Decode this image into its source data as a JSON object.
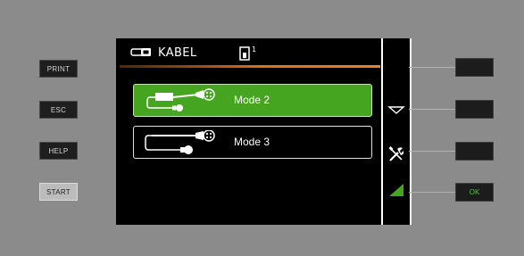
{
  "left_buttons": [
    {
      "label": "PRINT"
    },
    {
      "label": "ESC"
    },
    {
      "label": "HELP"
    },
    {
      "label": "START"
    }
  ],
  "screen": {
    "header": {
      "title": "KABEL",
      "cable_icon": "cable-plug-icon",
      "device_icon": "device-slot-icon",
      "device_index": "1",
      "accent_color": "#e86b17"
    },
    "modes": [
      {
        "label": "Mode 2",
        "icon": "cable-mode2-icon",
        "selected": true
      },
      {
        "label": "Mode 3",
        "icon": "cable-mode3-icon",
        "selected": false
      }
    ],
    "selected_color": "#46a520",
    "softkey_icons": [
      "down-triangle-icon",
      "tools-icon",
      "green-triangle-icon"
    ]
  },
  "right_buttons": [
    {
      "label": ""
    },
    {
      "label": ""
    },
    {
      "label": ""
    },
    {
      "label": "OK"
    }
  ]
}
